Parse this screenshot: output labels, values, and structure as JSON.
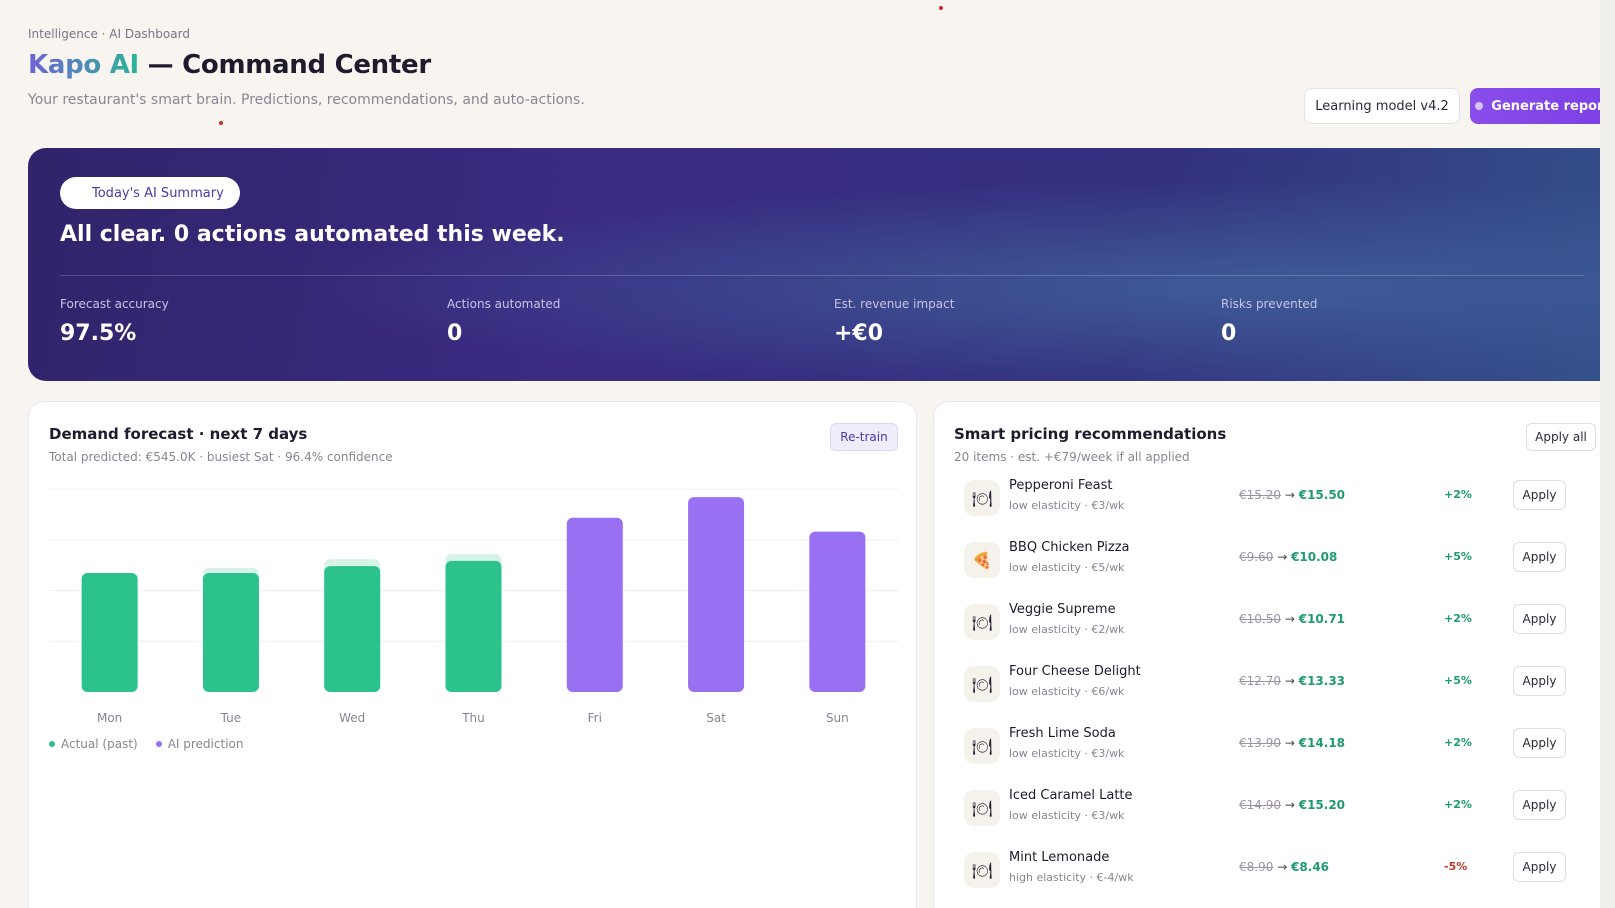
{
  "header": {
    "breadcrumb": "Intelligence · AI Dashboard",
    "brand": "Kapo AI",
    "title_rest": " — Command Center",
    "subtitle": "Your restaurant's smart brain. Predictions, recommendations, and auto-actions.",
    "model_button": "Learning model v4.2",
    "generate_button": "Generate report"
  },
  "hero": {
    "pill": "Today's AI Summary",
    "headline": "All clear. 0 actions automated this week.",
    "kpis": [
      {
        "label": "Forecast accuracy",
        "value": "97.5%"
      },
      {
        "label": "Actions automated",
        "value": "0"
      },
      {
        "label": "Est. revenue impact",
        "value": "+€0"
      },
      {
        "label": "Risks prevented",
        "value": "0"
      }
    ]
  },
  "forecast": {
    "title": "Demand forecast · next 7 days",
    "subtitle": "Total predicted: €545.0K · busiest Sat · 96.4% confidence",
    "retrain": "Re-train",
    "legend": {
      "actual": "Actual (past)",
      "prediction": "AI prediction"
    }
  },
  "chart_data": {
    "type": "bar",
    "categories": [
      "Mon",
      "Tue",
      "Wed",
      "Thu",
      "Fri",
      "Sat",
      "Sun"
    ],
    "series": [
      {
        "name": "Actual (past)",
        "values": [
          69,
          69,
          73,
          76,
          null,
          null,
          null
        ],
        "color": "#2bc28c"
      },
      {
        "name": "AI prediction",
        "values": [
          null,
          null,
          null,
          null,
          101,
          113,
          93
        ],
        "color": "#9a70f2"
      }
    ],
    "forecast_ghost": [
      69,
      72,
      77,
      80,
      null,
      null,
      null
    ],
    "ylim": [
      0,
      120
    ],
    "grid": true,
    "legend": "bottom-left"
  },
  "pricing": {
    "title": "Smart pricing recommendations",
    "subtitle": "20 items · est. +€79/week if all applied",
    "apply_all": "Apply all",
    "apply_label": "Apply",
    "arrow": "→",
    "items": [
      {
        "name": "Pepperoni Feast",
        "meta": "low elasticity · €3/wk",
        "old": "€15.20",
        "new": "€15.50",
        "change": "+2%",
        "icon": "🍽",
        "negative": false
      },
      {
        "name": "BBQ Chicken Pizza",
        "meta": "low elasticity · €5/wk",
        "old": "€9.60",
        "new": "€10.08",
        "change": "+5%",
        "icon": "🍕",
        "negative": false
      },
      {
        "name": "Veggie Supreme",
        "meta": "low elasticity · €2/wk",
        "old": "€10.50",
        "new": "€10.71",
        "change": "+2%",
        "icon": "🍽",
        "negative": false
      },
      {
        "name": "Four Cheese Delight",
        "meta": "low elasticity · €6/wk",
        "old": "€12.70",
        "new": "€13.33",
        "change": "+5%",
        "icon": "🍽",
        "negative": false
      },
      {
        "name": "Fresh Lime Soda",
        "meta": "low elasticity · €3/wk",
        "old": "€13.90",
        "new": "€14.18",
        "change": "+2%",
        "icon": "🍽",
        "negative": false
      },
      {
        "name": "Iced Caramel Latte",
        "meta": "low elasticity · €3/wk",
        "old": "€14.90",
        "new": "€15.20",
        "change": "+2%",
        "icon": "🍽",
        "negative": false
      },
      {
        "name": "Mint Lemonade",
        "meta": "high elasticity · €-4/wk",
        "old": "€8.90",
        "new": "€8.46",
        "change": "-5%",
        "icon": "🍽",
        "negative": true
      }
    ]
  }
}
